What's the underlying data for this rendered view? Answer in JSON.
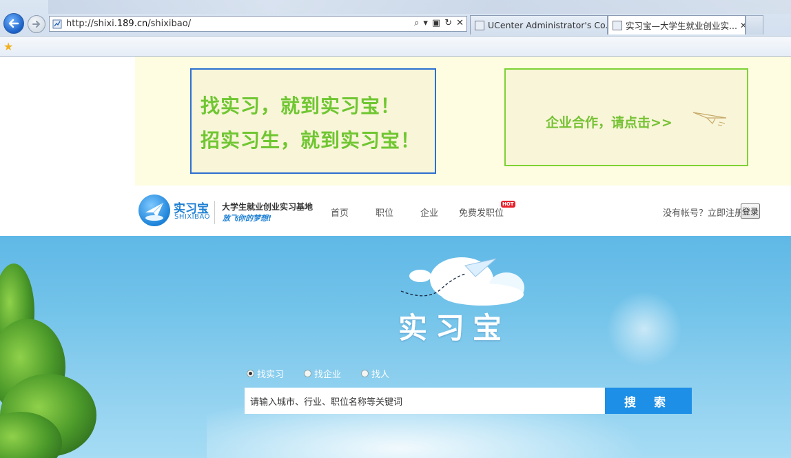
{
  "browser": {
    "address": {
      "url_prefix": "http://shixi.",
      "url_domain": "189.cn",
      "url_suffix": "/shixibao/"
    },
    "tabs": [
      {
        "label": "UCenter Administrator's Co...",
        "active": false
      },
      {
        "label": "实习宝—大学生就业创业实...",
        "active": true
      }
    ],
    "tab_close": "✕",
    "icons": [
      "back-arrow-icon",
      "forward-arrow-icon",
      "search-icon",
      "refresh-icon",
      "stop-icon",
      "favorites-star-icon"
    ]
  },
  "ad": {
    "slogan_line1": "找实习，就到实习宝！",
    "slogan_line2": "招实习生，就到实习宝！",
    "cta": "企业合作，请点击>>"
  },
  "header": {
    "logo_cn": "实习宝",
    "logo_en": "SHIXIBAO",
    "tagline": "大学生就业创业实习基地",
    "tagline_sub": "放飞你的梦想!",
    "nav": [
      "首页",
      "职位",
      "企业",
      "免费发职位"
    ],
    "hot_badge": "HOT",
    "no_account": "没有帐号？立即注册",
    "login": "登录"
  },
  "hero": {
    "title": "实习宝",
    "search_types": [
      {
        "label": "找实习",
        "selected": true
      },
      {
        "label": "找企业",
        "selected": false
      },
      {
        "label": "找人",
        "selected": false
      }
    ],
    "search_placeholder": "请输入城市、行业、职位名称等关键词",
    "search_button": "搜 索"
  },
  "colors": {
    "brand_blue": "#1d7fd3",
    "slogan_green": "#6fc631",
    "search_button": "#1e8fe6",
    "ad_bg": "#fefde1"
  }
}
